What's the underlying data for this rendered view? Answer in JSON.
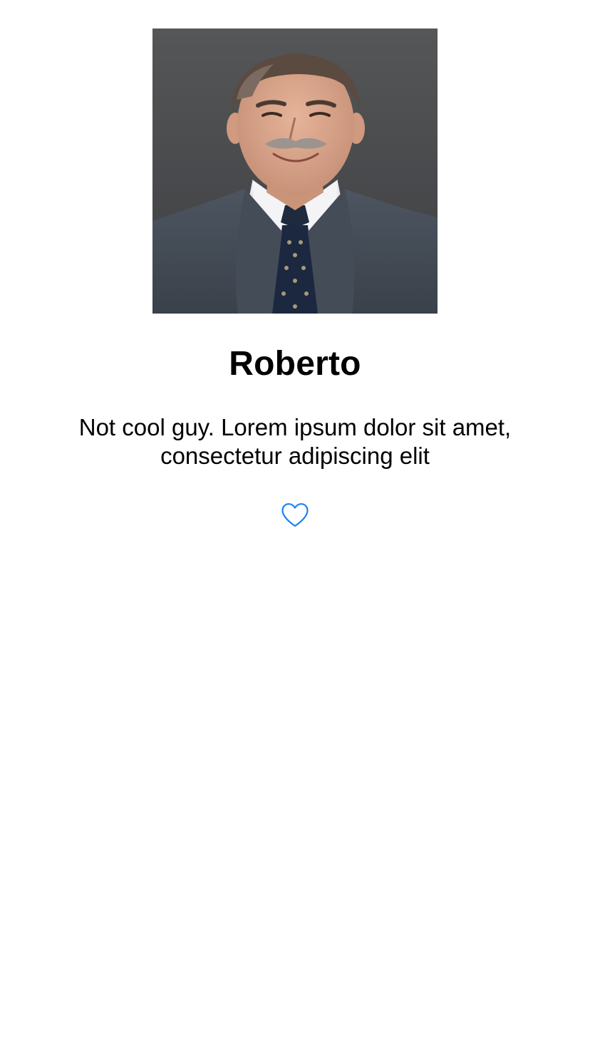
{
  "profile": {
    "photo_alt": "Roberto",
    "name": "Roberto",
    "bio": "Not cool guy. Lorem ipsum dolor sit amet, consectetur adipiscing elit",
    "favorite": {
      "icon": "heart-outline-icon",
      "active": false
    }
  },
  "colors": {
    "background": "#ffffff",
    "text": "#000000",
    "accent": "#1a82f7"
  }
}
